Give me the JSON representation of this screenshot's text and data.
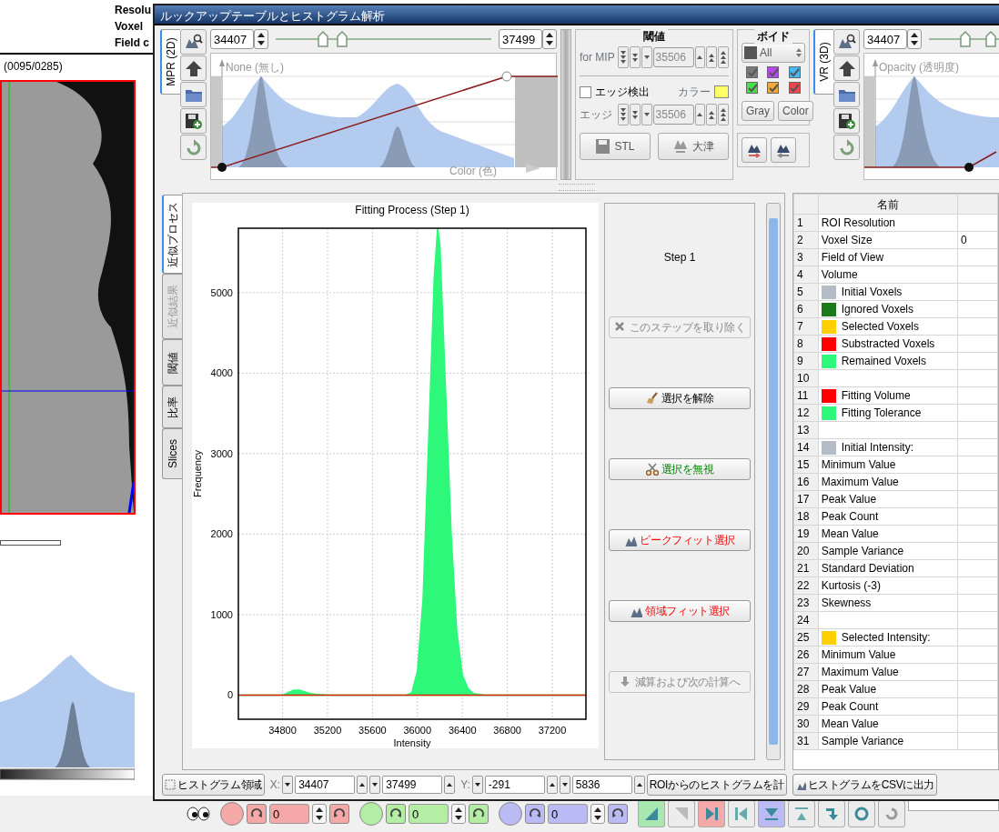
{
  "background": {
    "info_labels": [
      "Resolu",
      "Voxel",
      "Field c"
    ],
    "slice_label": "(0095/0285)",
    "toolbar": {
      "rotation_groups": [
        {
          "color": "#f4a8a8",
          "value": "0"
        },
        {
          "color": "#b4eea4",
          "value": "0"
        },
        {
          "color": "#babaf4",
          "value": "0"
        }
      ],
      "view_buttons": [
        {
          "color": "#a8e8b0"
        },
        {
          "color": "#ececec"
        },
        {
          "color": "#f4a8a8"
        },
        {
          "color": "#ececec"
        },
        {
          "color": "#babaf4"
        },
        {
          "color": "#ececec"
        },
        {
          "color": "#ececec"
        },
        {
          "color": "#ececec"
        },
        {
          "color": "#ececec"
        }
      ]
    }
  },
  "dialog": {
    "title": "ルックアップテーブルとヒストグラム解析",
    "mpr_panel": {
      "tab": "MPR (2D)",
      "min_value": "34407",
      "max_value": "37499",
      "thumbs": [
        {
          "level": 0.22
        },
        {
          "level": 0.31
        }
      ],
      "top_label": "None (無し)",
      "bottom_label": "Color (色)"
    },
    "threshold": {
      "title": "閾値",
      "mip_label": "for MIP",
      "mip_value": "35506",
      "edge_detect": {
        "label": "エッジ検出",
        "checked": false
      },
      "color_label": "カラー",
      "edge_label": "エッジ",
      "edge_value": "35506",
      "buttons": [
        "STL",
        "大津"
      ]
    },
    "void": {
      "title": "ボイド",
      "filter": "All",
      "classes": [
        {
          "color": "#7a7a7a",
          "checked": true
        },
        {
          "color": "#b848e8",
          "checked": true
        },
        {
          "color": "#48b8f0",
          "checked": true
        },
        {
          "color": "#48e048",
          "checked": true
        },
        {
          "color": "#f0a838",
          "checked": true
        },
        {
          "color": "#f04848",
          "checked": true
        }
      ],
      "buttons": [
        "Gray",
        "Color"
      ]
    },
    "vr_panel": {
      "tab": "VR (3D)",
      "min_value": "34407",
      "thumbs": [
        {
          "level": 0.13
        },
        {
          "level": 0.22
        }
      ],
      "top_label": "Opacity (透明度)"
    },
    "side_tabs": [
      {
        "label": "近似プロセス",
        "selected": true,
        "disabled": false
      },
      {
        "label": "近似結果",
        "selected": false,
        "disabled": true
      },
      {
        "label": "閾値",
        "selected": false,
        "disabled": false
      },
      {
        "label": "比率",
        "selected": false,
        "disabled": false
      },
      {
        "label": "Slices",
        "selected": false,
        "disabled": false
      }
    ],
    "chart_data": {
      "type": "area",
      "title": "Fitting Process (Step 1)",
      "xlabel": "Intensity",
      "ylabel": "Frequency",
      "x": [
        34407,
        34700,
        34800,
        34850,
        34900,
        34950,
        35000,
        35050,
        35100,
        35200,
        35400,
        35600,
        35800,
        35900,
        35950,
        36000,
        36050,
        36100,
        36150,
        36180,
        36200,
        36250,
        36300,
        36350,
        36400,
        36450,
        36500,
        36600,
        37000,
        37499
      ],
      "series": [
        {
          "color": "#2ef87a",
          "values": [
            0,
            0,
            0,
            30,
            60,
            60,
            40,
            20,
            10,
            0,
            0,
            0,
            0,
            0,
            30,
            300,
            1200,
            3200,
            5200,
            5800,
            5600,
            3800,
            2000,
            800,
            250,
            80,
            20,
            0,
            0,
            0
          ]
        },
        {
          "color": "#e02000",
          "values": [
            0,
            0,
            0,
            0,
            0,
            0,
            0,
            0,
            0,
            0,
            0,
            0,
            0,
            0,
            0,
            0,
            0,
            0,
            0,
            0,
            0,
            0,
            0,
            0,
            0,
            0,
            0,
            0,
            0,
            0
          ]
        }
      ],
      "grid": true,
      "xlim": [
        34407,
        37499
      ],
      "ylim": [
        -300,
        5800
      ],
      "xticks": [
        34800,
        35200,
        35600,
        36000,
        36400,
        36800,
        37200
      ],
      "yticks": [
        0,
        1000,
        2000,
        3000,
        4000,
        5000
      ]
    },
    "step_panel": {
      "title": "Step 1",
      "buttons": [
        {
          "label": "このステップを取り除く",
          "disabled": true
        },
        {
          "label": "選択を解除",
          "disabled": false,
          "kind": "normal"
        },
        {
          "label": "選択を無視",
          "disabled": false,
          "kind": "ignore"
        },
        {
          "label": "ピークフィット選択",
          "disabled": false,
          "kind": "fit"
        },
        {
          "label": "領域フィット選択",
          "disabled": false,
          "kind": "fit"
        },
        {
          "label": "減算および次の計算へ",
          "disabled": true
        }
      ]
    },
    "table": {
      "columns": [
        "名前"
      ],
      "rows": [
        {
          "number": "1",
          "name": "ROI Resolution"
        },
        {
          "number": "2",
          "name": "Voxel Size",
          "column_3": "0"
        },
        {
          "number": "3",
          "name": "Field of View"
        },
        {
          "number": "4",
          "name": "Volume"
        },
        {
          "number": "5",
          "name": "Initial Voxels",
          "color": "#b4bcc6"
        },
        {
          "number": "6",
          "name": "Ignored Voxels",
          "color": "#1a7a1a"
        },
        {
          "number": "7",
          "name": "Selected Voxels",
          "color": "#ffd000"
        },
        {
          "number": "8",
          "name": "Substracted Voxels",
          "color": "#ff0000"
        },
        {
          "number": "9",
          "name": "Remained Voxels",
          "color": "#2ef87a"
        },
        {
          "number": "10"
        },
        {
          "number": "11",
          "name": "Fitting Volume",
          "color": "#ff0000"
        },
        {
          "number": "12",
          "name": "Fitting Tolerance",
          "color": "#2ef87a"
        },
        {
          "number": "13"
        },
        {
          "number": "14",
          "name": "Initial Intensity:",
          "color": "#b4bcc6"
        },
        {
          "number": "15",
          "name": "Minimum Value"
        },
        {
          "number": "16",
          "name": "Maximum Value"
        },
        {
          "number": "17",
          "name": "Peak Value"
        },
        {
          "number": "18",
          "name": "Peak Count"
        },
        {
          "number": "19",
          "name": "Mean Value"
        },
        {
          "number": "20",
          "name": "Sample Variance"
        },
        {
          "number": "21",
          "name": "Standard Deviation"
        },
        {
          "number": "22",
          "name": "Kurtosis (-3)"
        },
        {
          "number": "23",
          "name": "Skewness"
        },
        {
          "number": "24"
        },
        {
          "number": "25",
          "name": "Selected Intensity:",
          "color": "#ffd000"
        },
        {
          "number": "26",
          "name": "Minimum Value"
        },
        {
          "number": "27",
          "name": "Maximum Value"
        },
        {
          "number": "28",
          "name": "Peak Value"
        },
        {
          "number": "29",
          "name": "Peak Count"
        },
        {
          "number": "30",
          "name": "Mean Value"
        },
        {
          "number": "31",
          "name": "Sample Variance"
        }
      ]
    },
    "bottom_bar": {
      "region_button": "ヒストグラム領域",
      "x_label": "X:",
      "x_min": "34407",
      "x_max": "37499",
      "y_label": "Y:",
      "y_min": "-291",
      "y_max": "5836",
      "roi_button": "ROIからのヒストグラムを計",
      "csv_button": "ヒストグラムをCSVに出力"
    }
  }
}
